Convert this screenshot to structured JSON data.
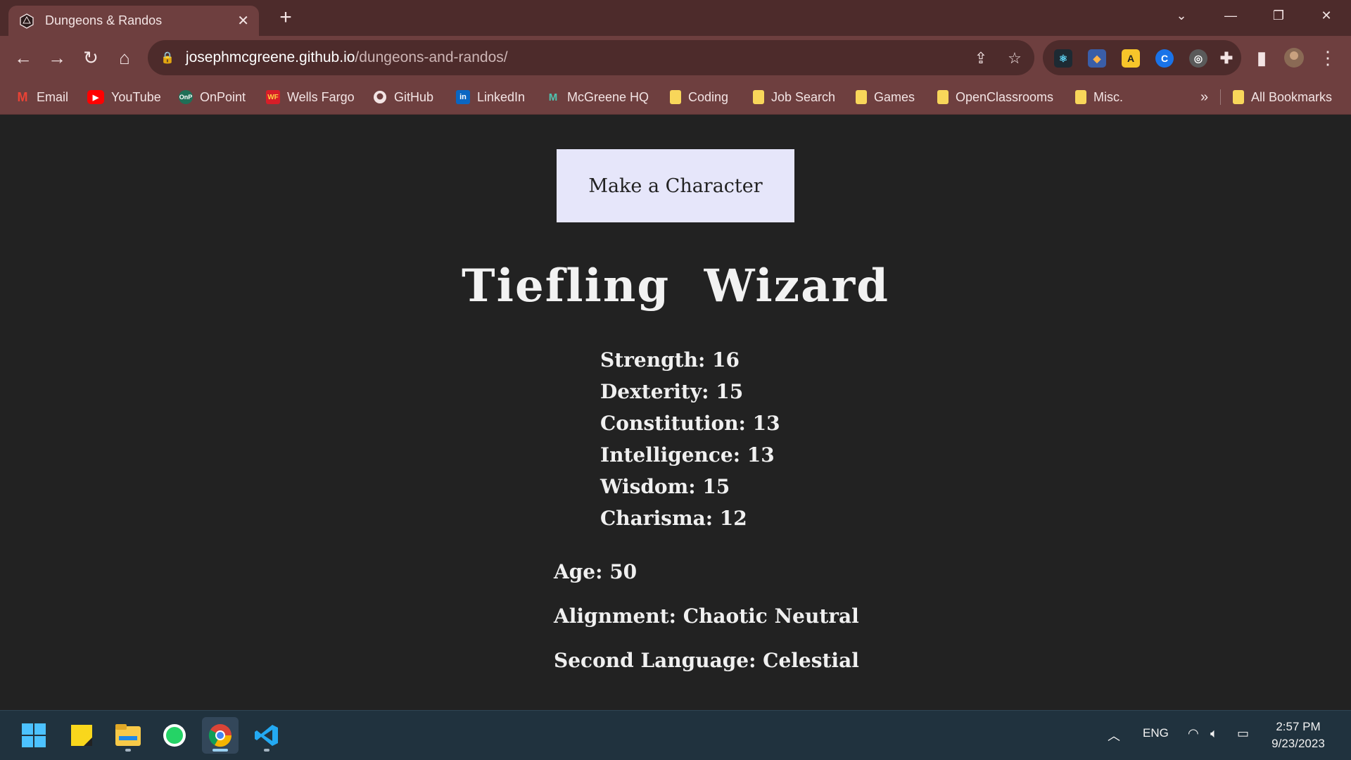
{
  "browser": {
    "tab": {
      "title": "Dungeons & Randos"
    },
    "address": {
      "host": "josephmcgreene.github.io",
      "path": "/dungeons-and-randos/"
    },
    "bookmarks": [
      {
        "label": "Email",
        "icon": "gmail-icon"
      },
      {
        "label": "YouTube",
        "icon": "youtube-icon"
      },
      {
        "label": "OnPoint",
        "icon": "onpoint-icon"
      },
      {
        "label": "Wells Fargo",
        "icon": "wells-fargo-icon"
      },
      {
        "label": "GitHub",
        "icon": "github-icon"
      },
      {
        "label": "LinkedIn",
        "icon": "linkedin-icon"
      },
      {
        "label": "McGreene HQ",
        "icon": "mcgreene-icon"
      },
      {
        "label": "Coding",
        "icon": "folder-icon"
      },
      {
        "label": "Job Search",
        "icon": "folder-icon"
      },
      {
        "label": "Games",
        "icon": "folder-icon"
      },
      {
        "label": "OpenClassrooms",
        "icon": "folder-icon"
      },
      {
        "label": "Misc.",
        "icon": "folder-icon"
      }
    ],
    "overflow_label": "»",
    "all_bookmarks": "All Bookmarks"
  },
  "page": {
    "button_label": "Make a Character",
    "character_title": "Tiefling  Wizard",
    "stats": [
      "Strength: 16",
      "Dexterity: 15",
      "Constitution: 13",
      "Intelligence: 13",
      "Wisdom: 15",
      "Charisma: 12"
    ],
    "age": "Age: 50",
    "alignment": "Alignment: Chaotic Neutral",
    "language": "Second Language: Celestial"
  },
  "taskbar": {
    "language": "ENG",
    "time": "2:57 PM",
    "date": "9/23/2023"
  },
  "colors": {
    "window_frame": "#4d2b2b",
    "toolbar": "#6e3f3f",
    "page_bg": "#222222",
    "button_bg": "#e6e6fa",
    "taskbar": "#20323e"
  }
}
